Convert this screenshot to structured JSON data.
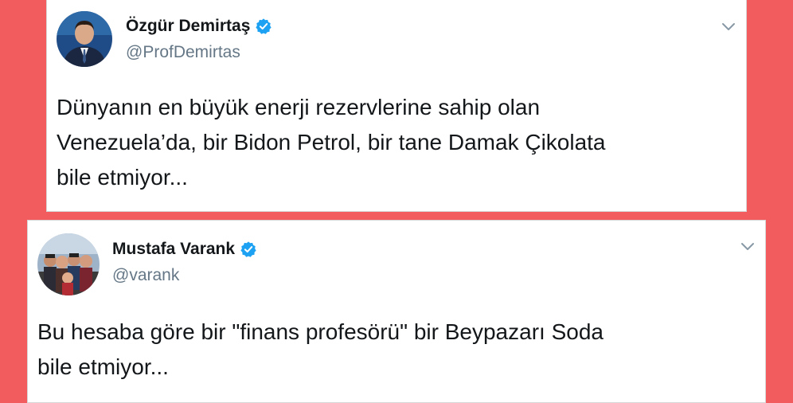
{
  "colors": {
    "background": "#f25c5e",
    "card": "#ffffff",
    "name": "#14171a",
    "handle": "#657786",
    "verified": "#1da1f2"
  },
  "tweets": [
    {
      "author_name": "Özgür Demirtaş",
      "handle": "@ProfDemirtas",
      "verified": true,
      "avatar_icon": "avatar-photo",
      "menu_icon": "chevron-down-icon",
      "text_lines": [
        "Dünyanın en büyük enerji rezervlerine sahip olan",
        "Venezuela’da, bir Bidon Petrol, bir tane Damak Çikolata",
        "bile etmiyor..."
      ]
    },
    {
      "author_name": "Mustafa Varank",
      "handle": "@varank",
      "verified": true,
      "avatar_icon": "avatar-photo",
      "menu_icon": "chevron-down-icon",
      "text_lines": [
        "Bu hesaba göre bir \"finans profesörü\" bir Beypazarı Soda",
        "bile etmiyor..."
      ]
    }
  ]
}
